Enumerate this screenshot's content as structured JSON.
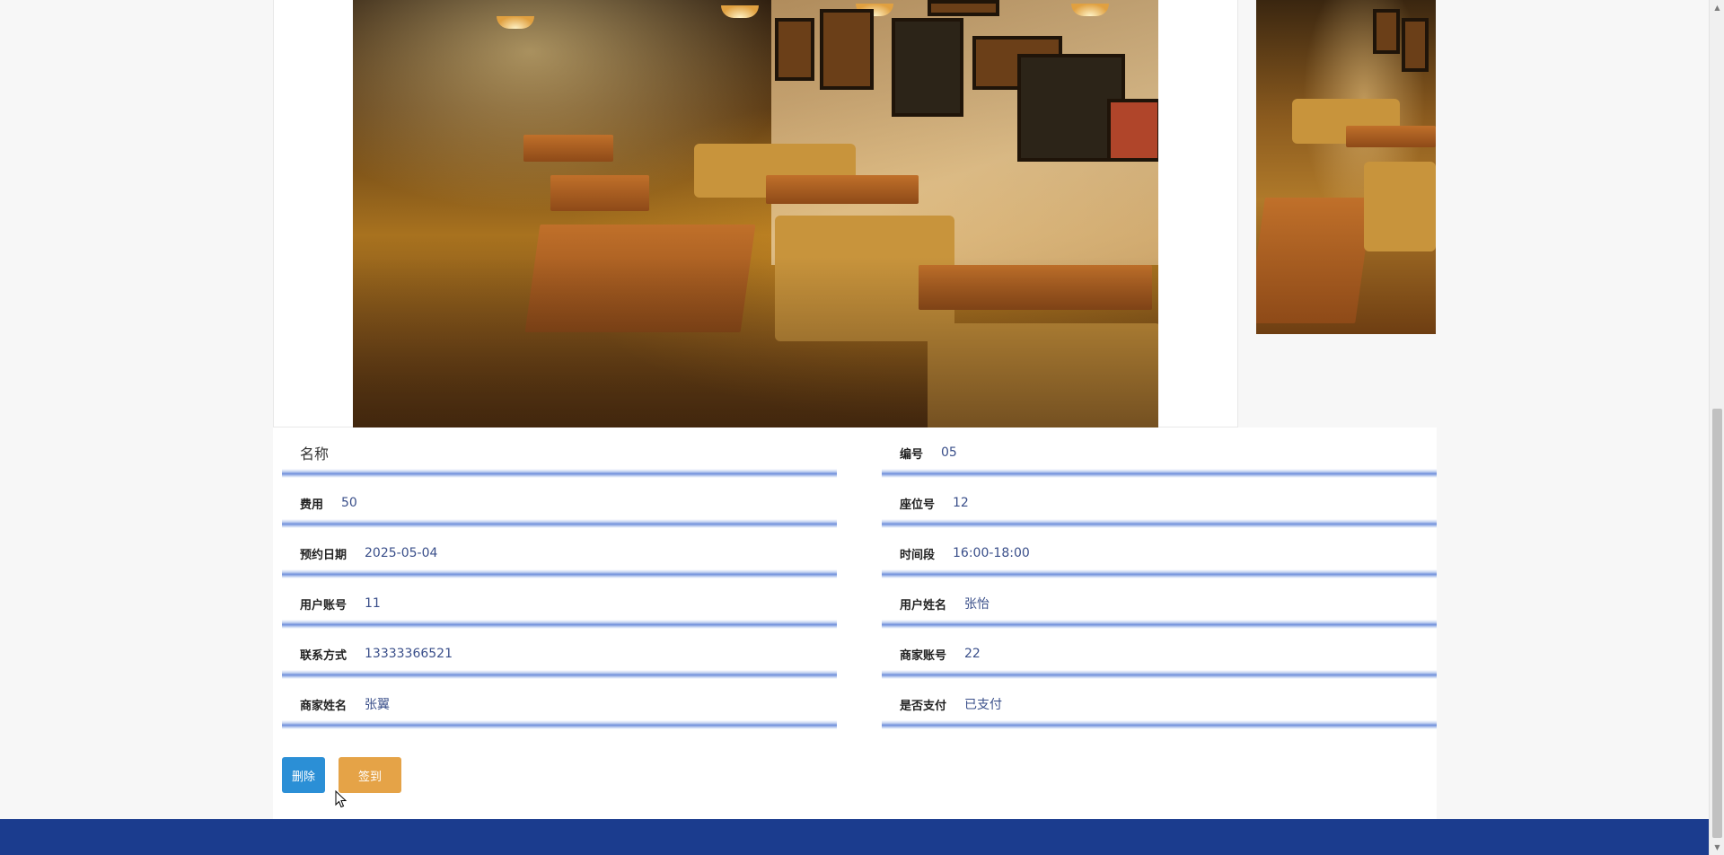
{
  "photos": {
    "main_alt": "",
    "thumb_alt": ""
  },
  "details": {
    "fields": {
      "name": {
        "label": "名称",
        "value": ""
      },
      "number": {
        "label": "编号",
        "value": "05"
      },
      "fee": {
        "label": "费用",
        "value": "50"
      },
      "seat_no": {
        "label": "座位号",
        "value": "12"
      },
      "booking_date": {
        "label": "预约日期",
        "value": "2025-05-04"
      },
      "time_slot": {
        "label": "时间段",
        "value": "16:00-18:00"
      },
      "user_account": {
        "label": "用户账号",
        "value": "11"
      },
      "user_name": {
        "label": "用户姓名",
        "value": "张怡"
      },
      "contact": {
        "label": "联系方式",
        "value": "13333366521"
      },
      "merchant_account": {
        "label": "商家账号",
        "value": "22"
      },
      "merchant_name": {
        "label": "商家姓名",
        "value": "张翼"
      },
      "paid": {
        "label": "是否支付",
        "value": "已支付"
      }
    },
    "buttons": {
      "delete_label": "删除",
      "checkin_label": "签到"
    }
  },
  "colors": {
    "delete_button": "#2b8fd6",
    "checkin_button": "#e5a347",
    "footer": "#1b3c8e",
    "field_underline": "#6f8fdb"
  }
}
